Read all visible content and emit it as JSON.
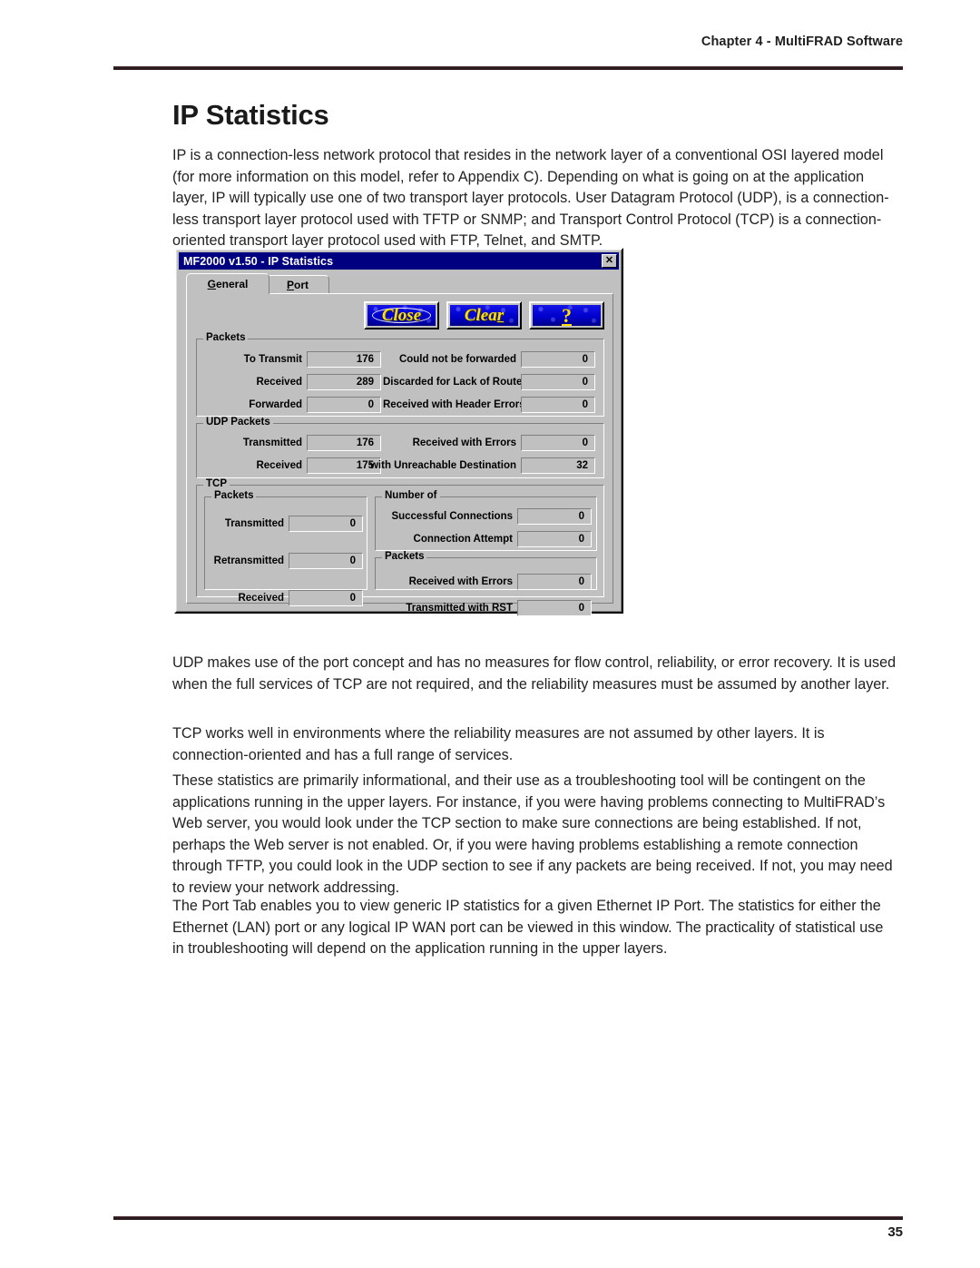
{
  "page": {
    "header": "Chapter 4 - MultiFRAD Software",
    "title": "IP Statistics",
    "number": "35"
  },
  "paragraphs": {
    "intro": "IP is a connection-less network protocol that resides in the network layer of a conventional OSI layered model (for more information on this model, refer to Appendix C). Depending on what is going on at the application layer, IP will typically use one of two transport layer protocols. User Datagram Protocol (UDP), is a connection-less transport layer protocol used with TFTP or SNMP; and Transport Control Protocol (TCP) is a connection-oriented transport layer protocol used with FTP, Telnet, and SMTP.",
    "udp": "UDP makes use of the port concept and has no measures for flow control, reliability, or error recovery. It is used when the full services of TCP are not required, and the reliability measures must be assumed by another layer.",
    "tcp": "TCP works well in environments where the reliability measures are not assumed by other layers. It is connection-oriented and has a full range of services.",
    "stats": "These statistics are primarily informational, and their use as a troubleshooting tool will be contingent on the applications running in the upper layers. For instance, if you were having problems connecting to MultiFRAD’s Web server, you would look under the TCP section to make sure connections are being established. If not, perhaps the Web server is not enabled. Or, if you were having problems establishing a remote connection through TFTP, you could look in the UDP section to see if any packets are being received. If not, you may need to review your network addressing.",
    "port": "The Port Tab enables you to view generic IP statistics for a given Ethernet IP Port. The statistics for either the Ethernet (LAN) port or any logical IP WAN port can be viewed in this window. The practicality of statistical use in troubleshooting will depend on the application running in the upper layers."
  },
  "dialog": {
    "title": "MF2000 v1.50 - IP Statistics",
    "close_icon": "close-icon",
    "tabs": [
      {
        "label": "General",
        "accel": "G",
        "active": true
      },
      {
        "label": "Port",
        "accel": "P",
        "active": false
      }
    ],
    "buttons": [
      {
        "name": "close-button",
        "label": "Close",
        "accel": "",
        "shape": "ellipse"
      },
      {
        "name": "clear-button",
        "label": "Clear",
        "accel": "r",
        "shape": "plain"
      },
      {
        "name": "help-button",
        "label": "?",
        "accel": "",
        "shape": "help"
      }
    ],
    "colors": {
      "titlebar": "#000080",
      "dialog_face": "#c0c0c0",
      "button_face": "#0000cd",
      "button_text": "#ffe000"
    },
    "groups": {
      "packets": {
        "label": "Packets",
        "left": [
          {
            "label": "To Transmit",
            "value": "176"
          },
          {
            "label": "Received",
            "value": "289"
          },
          {
            "label": "Forwarded",
            "value": "0"
          }
        ],
        "right": [
          {
            "label": "Could not be forwarded",
            "value": "0"
          },
          {
            "label": "Discarded for Lack of Route",
            "value": "0"
          },
          {
            "label": "Received with Header Errors",
            "value": "0"
          }
        ]
      },
      "udp_packets": {
        "label": "UDP Packets",
        "left": [
          {
            "label": "Transmitted",
            "value": "176"
          },
          {
            "label": "Received",
            "value": "175"
          }
        ],
        "right": [
          {
            "label": "Received with Errors",
            "value": "0"
          },
          {
            "label": "with Unreachable Destination",
            "value": "32"
          }
        ]
      },
      "tcp": {
        "label": "TCP",
        "packets": {
          "label": "Packets",
          "rows": [
            {
              "label": "Transmitted",
              "value": "0"
            },
            {
              "label": "Retransmitted",
              "value": "0"
            },
            {
              "label": "Received",
              "value": "0"
            }
          ]
        },
        "number_of": {
          "label": "Number of",
          "rows": [
            {
              "label": "Successful Connections",
              "value": "0"
            },
            {
              "label": "Connection Attempt",
              "value": "0"
            }
          ]
        },
        "packets_right": {
          "label": "Packets",
          "rows": [
            {
              "label": "Received with Errors",
              "value": "0"
            },
            {
              "label": "Transmitted with RST",
              "value": "0"
            }
          ]
        }
      }
    }
  }
}
